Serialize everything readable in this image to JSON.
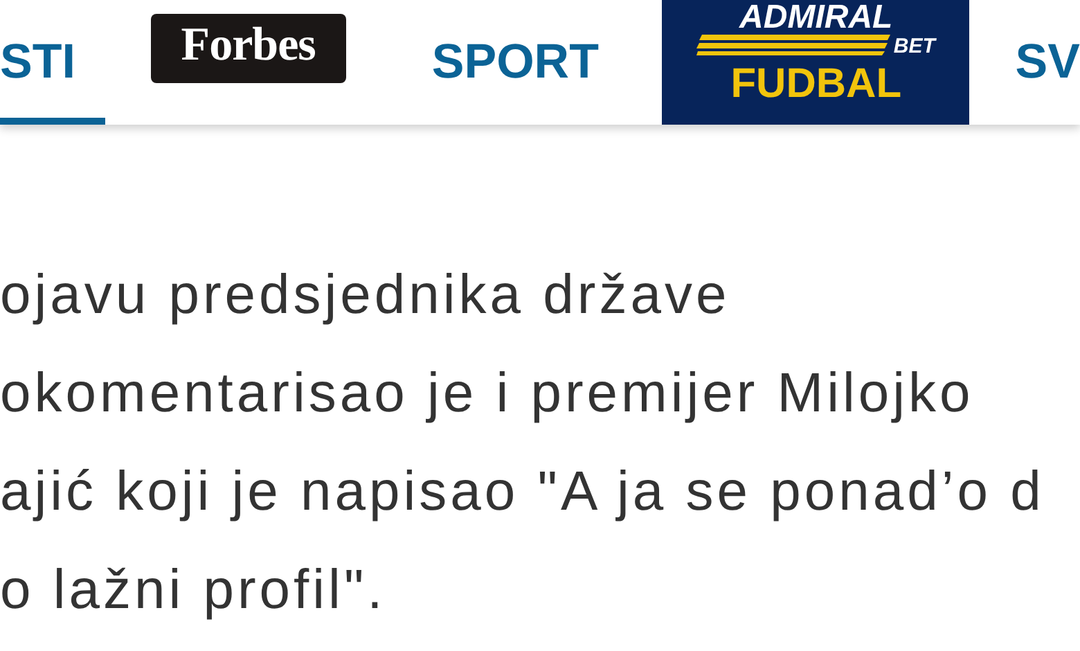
{
  "nav": {
    "tabs": [
      {
        "kind": "text",
        "label": "STI",
        "selected": true
      },
      {
        "kind": "badge",
        "label": "Forbes",
        "selected": false
      },
      {
        "kind": "text",
        "label": "SPORT",
        "selected": false
      },
      {
        "kind": "sponsor",
        "brand": "ADMIRAL",
        "sub": "BET",
        "label": "FUDBAL",
        "selected": false
      },
      {
        "kind": "text",
        "label": "SV",
        "selected": false
      }
    ]
  },
  "article": {
    "lines": [
      "ojavu predsjednika države",
      "okomentarisao je i premijer Milojko",
      "ajić koji je napisao \"A ja se ponad’o d",
      "o lažni profil\"."
    ]
  }
}
